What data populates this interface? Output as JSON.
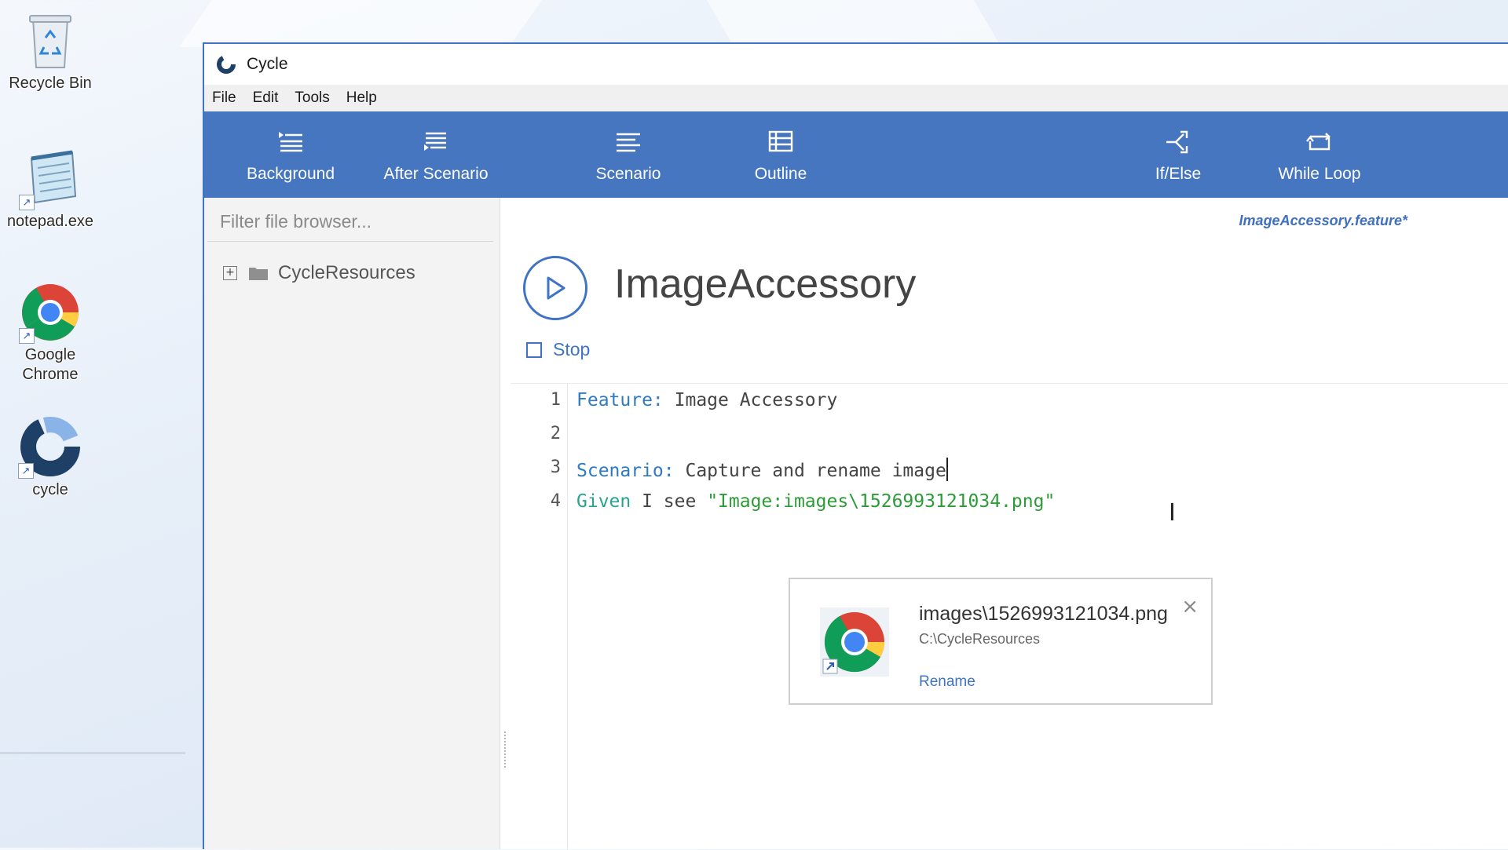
{
  "desktop": {
    "icons": [
      {
        "label": "Recycle Bin",
        "icon": "recycle-bin-icon"
      },
      {
        "label": "notepad.exe",
        "icon": "notepad-icon"
      },
      {
        "label": "Google Chrome",
        "icon": "chrome-icon"
      },
      {
        "label": "cycle",
        "icon": "cycle-app-icon"
      }
    ]
  },
  "window": {
    "title": "Cycle",
    "menu": [
      "File",
      "Edit",
      "Tools",
      "Help"
    ]
  },
  "toolbar": {
    "buttons": [
      {
        "label": "Background",
        "icon": "background-icon"
      },
      {
        "label": "After Scenario",
        "icon": "after-scenario-icon"
      },
      {
        "label": "Scenario",
        "icon": "scenario-icon"
      },
      {
        "label": "Outline",
        "icon": "outline-icon"
      },
      {
        "label": "If/Else",
        "icon": "if-else-icon"
      },
      {
        "label": "While Loop",
        "icon": "while-loop-icon"
      }
    ]
  },
  "sidebar": {
    "filter_placeholder": "Filter file browser...",
    "tree": [
      {
        "label": "CycleResources",
        "expander": "+"
      }
    ]
  },
  "editor": {
    "file_name": "ImageAccessory.feature*",
    "feature_title": "ImageAccessory",
    "stop_label": "Stop",
    "lines": [
      {
        "num": "1",
        "keyword": "Feature:",
        "text": " Image Accessory"
      },
      {
        "num": "2",
        "keyword": "",
        "text": ""
      },
      {
        "num": "3",
        "keyword": "Scenario:",
        "text": " Capture and rename image"
      },
      {
        "num": "4",
        "keyword": "Given",
        "text": " I see ",
        "string": "\"Image:images\\1526993121034.png\""
      }
    ]
  },
  "image_card": {
    "title": "images\\1526993121034.png",
    "path": "C:\\CycleResources",
    "action": "Rename",
    "close": "×"
  },
  "colors": {
    "accent": "#4676bf",
    "keyword_blue": "#2e7bc4",
    "keyword_teal": "#27a393",
    "string_green": "#2c9c36"
  }
}
